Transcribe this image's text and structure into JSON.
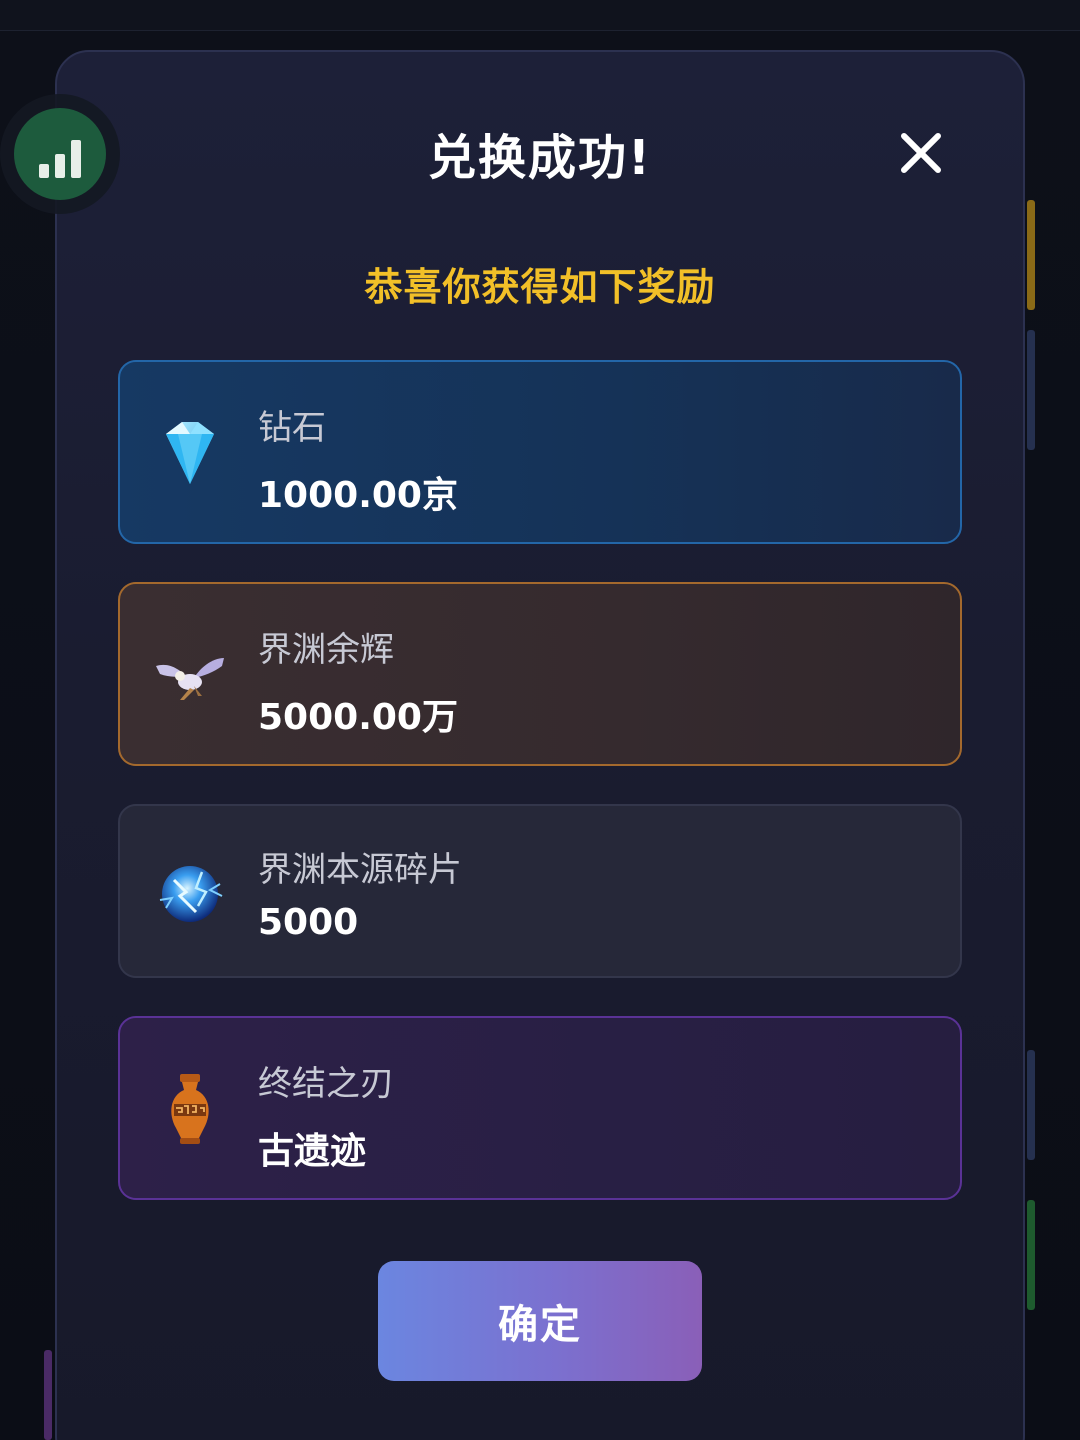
{
  "dialog": {
    "title": "兑换成功!",
    "subtitle": "恭喜你获得如下奖励",
    "confirm_label": "确定"
  },
  "rewards": [
    {
      "name": "钻石",
      "amount": "1000.00京",
      "icon": "diamond-icon",
      "accent": "#2366a8"
    },
    {
      "name": "界渊余辉",
      "amount": "5000.00万",
      "icon": "winged-creature-icon",
      "accent": "#a4692d"
    },
    {
      "name": "界渊本源碎片",
      "amount": "5000",
      "icon": "lightning-orb-icon",
      "accent": "#33364b"
    },
    {
      "name": "终结之刃",
      "amount": "古遗迹",
      "icon": "ancient-vase-icon",
      "accent": "#5a3296"
    }
  ],
  "colors": {
    "subtitle": "#f2c028",
    "confirm_gradient_start": "#6b86e0",
    "confirm_gradient_end": "#8a5fb8",
    "stats_fab": "#1d5b3d"
  },
  "icons": {
    "stats": "bar-chart-icon",
    "close": "close-icon"
  }
}
